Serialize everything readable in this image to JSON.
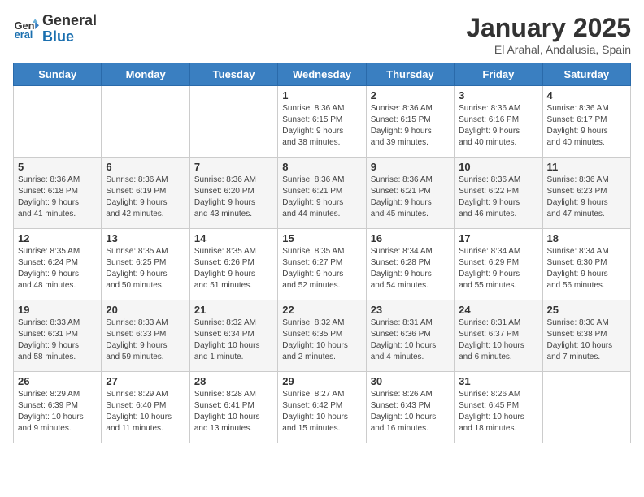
{
  "logo": {
    "line1": "General",
    "line2": "Blue"
  },
  "title": "January 2025",
  "subtitle": "El Arahal, Andalusia, Spain",
  "days_header": [
    "Sunday",
    "Monday",
    "Tuesday",
    "Wednesday",
    "Thursday",
    "Friday",
    "Saturday"
  ],
  "weeks": [
    [
      {
        "day": "",
        "info": ""
      },
      {
        "day": "",
        "info": ""
      },
      {
        "day": "",
        "info": ""
      },
      {
        "day": "1",
        "info": "Sunrise: 8:36 AM\nSunset: 6:15 PM\nDaylight: 9 hours\nand 38 minutes."
      },
      {
        "day": "2",
        "info": "Sunrise: 8:36 AM\nSunset: 6:15 PM\nDaylight: 9 hours\nand 39 minutes."
      },
      {
        "day": "3",
        "info": "Sunrise: 8:36 AM\nSunset: 6:16 PM\nDaylight: 9 hours\nand 40 minutes."
      },
      {
        "day": "4",
        "info": "Sunrise: 8:36 AM\nSunset: 6:17 PM\nDaylight: 9 hours\nand 40 minutes."
      }
    ],
    [
      {
        "day": "5",
        "info": "Sunrise: 8:36 AM\nSunset: 6:18 PM\nDaylight: 9 hours\nand 41 minutes."
      },
      {
        "day": "6",
        "info": "Sunrise: 8:36 AM\nSunset: 6:19 PM\nDaylight: 9 hours\nand 42 minutes."
      },
      {
        "day": "7",
        "info": "Sunrise: 8:36 AM\nSunset: 6:20 PM\nDaylight: 9 hours\nand 43 minutes."
      },
      {
        "day": "8",
        "info": "Sunrise: 8:36 AM\nSunset: 6:21 PM\nDaylight: 9 hours\nand 44 minutes."
      },
      {
        "day": "9",
        "info": "Sunrise: 8:36 AM\nSunset: 6:21 PM\nDaylight: 9 hours\nand 45 minutes."
      },
      {
        "day": "10",
        "info": "Sunrise: 8:36 AM\nSunset: 6:22 PM\nDaylight: 9 hours\nand 46 minutes."
      },
      {
        "day": "11",
        "info": "Sunrise: 8:36 AM\nSunset: 6:23 PM\nDaylight: 9 hours\nand 47 minutes."
      }
    ],
    [
      {
        "day": "12",
        "info": "Sunrise: 8:35 AM\nSunset: 6:24 PM\nDaylight: 9 hours\nand 48 minutes."
      },
      {
        "day": "13",
        "info": "Sunrise: 8:35 AM\nSunset: 6:25 PM\nDaylight: 9 hours\nand 50 minutes."
      },
      {
        "day": "14",
        "info": "Sunrise: 8:35 AM\nSunset: 6:26 PM\nDaylight: 9 hours\nand 51 minutes."
      },
      {
        "day": "15",
        "info": "Sunrise: 8:35 AM\nSunset: 6:27 PM\nDaylight: 9 hours\nand 52 minutes."
      },
      {
        "day": "16",
        "info": "Sunrise: 8:34 AM\nSunset: 6:28 PM\nDaylight: 9 hours\nand 54 minutes."
      },
      {
        "day": "17",
        "info": "Sunrise: 8:34 AM\nSunset: 6:29 PM\nDaylight: 9 hours\nand 55 minutes."
      },
      {
        "day": "18",
        "info": "Sunrise: 8:34 AM\nSunset: 6:30 PM\nDaylight: 9 hours\nand 56 minutes."
      }
    ],
    [
      {
        "day": "19",
        "info": "Sunrise: 8:33 AM\nSunset: 6:31 PM\nDaylight: 9 hours\nand 58 minutes."
      },
      {
        "day": "20",
        "info": "Sunrise: 8:33 AM\nSunset: 6:33 PM\nDaylight: 9 hours\nand 59 minutes."
      },
      {
        "day": "21",
        "info": "Sunrise: 8:32 AM\nSunset: 6:34 PM\nDaylight: 10 hours\nand 1 minute."
      },
      {
        "day": "22",
        "info": "Sunrise: 8:32 AM\nSunset: 6:35 PM\nDaylight: 10 hours\nand 2 minutes."
      },
      {
        "day": "23",
        "info": "Sunrise: 8:31 AM\nSunset: 6:36 PM\nDaylight: 10 hours\nand 4 minutes."
      },
      {
        "day": "24",
        "info": "Sunrise: 8:31 AM\nSunset: 6:37 PM\nDaylight: 10 hours\nand 6 minutes."
      },
      {
        "day": "25",
        "info": "Sunrise: 8:30 AM\nSunset: 6:38 PM\nDaylight: 10 hours\nand 7 minutes."
      }
    ],
    [
      {
        "day": "26",
        "info": "Sunrise: 8:29 AM\nSunset: 6:39 PM\nDaylight: 10 hours\nand 9 minutes."
      },
      {
        "day": "27",
        "info": "Sunrise: 8:29 AM\nSunset: 6:40 PM\nDaylight: 10 hours\nand 11 minutes."
      },
      {
        "day": "28",
        "info": "Sunrise: 8:28 AM\nSunset: 6:41 PM\nDaylight: 10 hours\nand 13 minutes."
      },
      {
        "day": "29",
        "info": "Sunrise: 8:27 AM\nSunset: 6:42 PM\nDaylight: 10 hours\nand 15 minutes."
      },
      {
        "day": "30",
        "info": "Sunrise: 8:26 AM\nSunset: 6:43 PM\nDaylight: 10 hours\nand 16 minutes."
      },
      {
        "day": "31",
        "info": "Sunrise: 8:26 AM\nSunset: 6:45 PM\nDaylight: 10 hours\nand 18 minutes."
      },
      {
        "day": "",
        "info": ""
      }
    ]
  ]
}
